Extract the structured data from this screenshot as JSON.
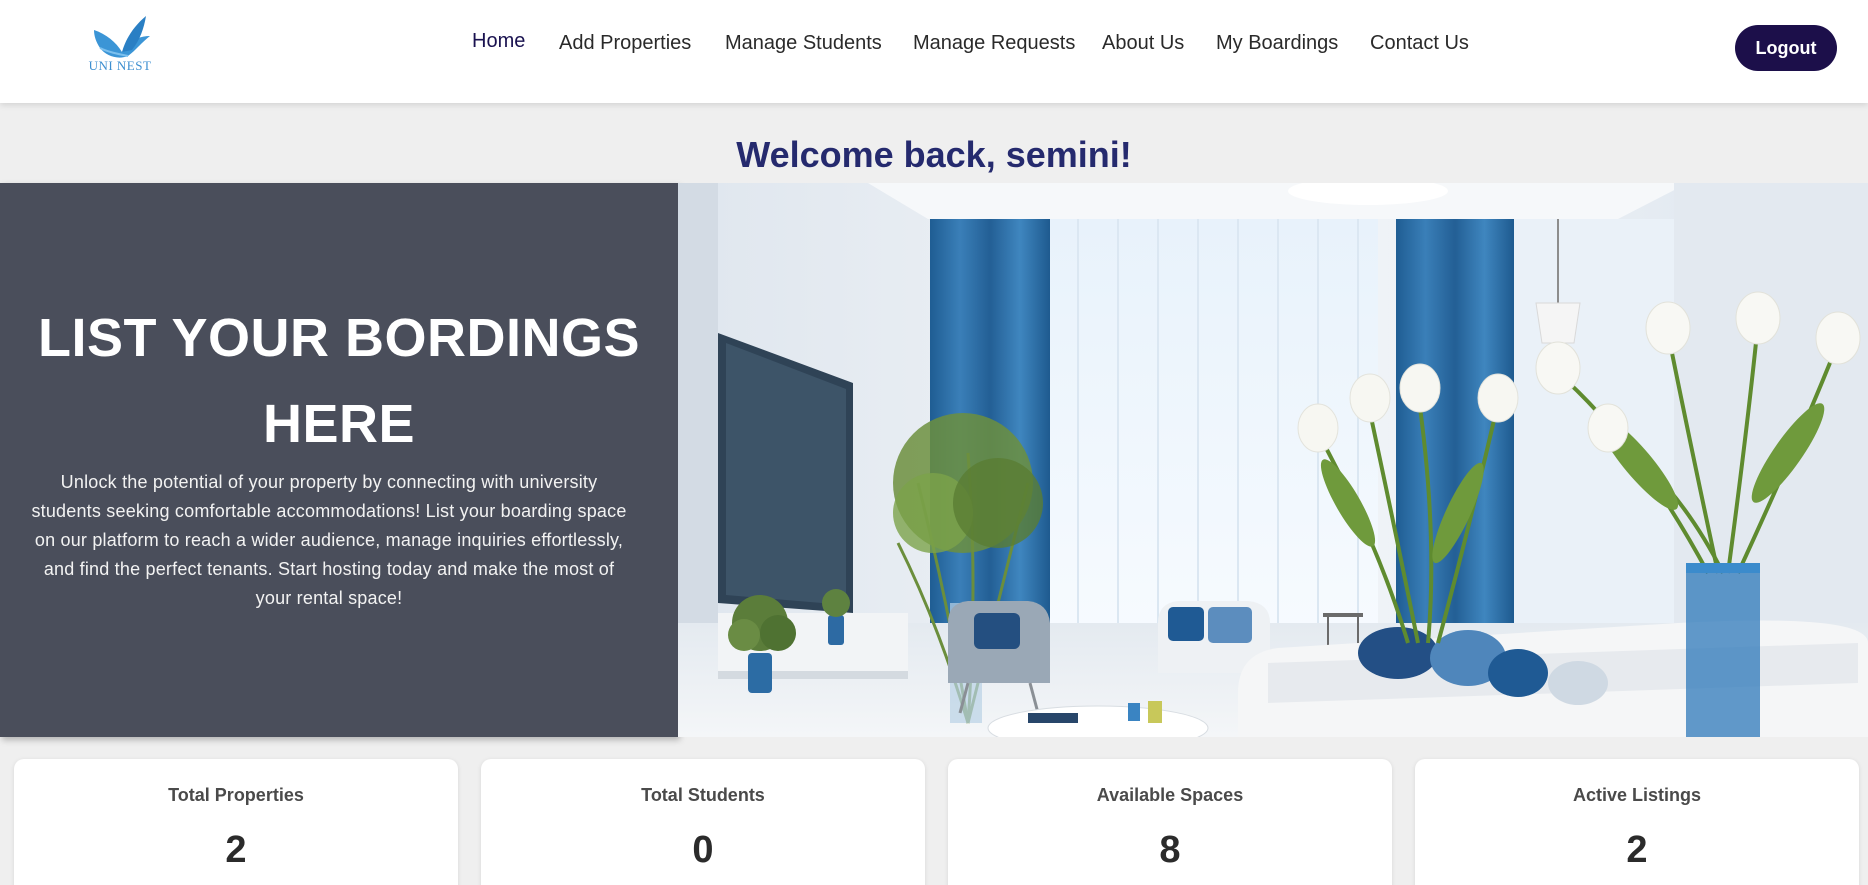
{
  "brand": {
    "logo_text": "UNI NEST",
    "accent": "#3d8fd0"
  },
  "nav": {
    "items": [
      {
        "label": "Home",
        "active": true
      },
      {
        "label": "Add Properties"
      },
      {
        "label": "Manage Students"
      },
      {
        "label": "Manage Requests"
      },
      {
        "label": "About Us"
      },
      {
        "label": "My Boardings"
      },
      {
        "label": "Contact Us"
      }
    ],
    "logout_label": "Logout"
  },
  "welcome": {
    "text": "Welcome back, semini!"
  },
  "hero": {
    "title_line1": "LIST YOUR BORDINGS",
    "title_line2": "HERE",
    "description": "Unlock the potential of your property by connecting with university students seeking comfortable accommodations! List your boarding space on our platform to reach a wider audience, manage inquiries effortlessly, and find the perfect tenants. Start hosting today and make the most of your rental space!"
  },
  "stats": [
    {
      "label": "Total Properties",
      "value": "2"
    },
    {
      "label": "Total Students",
      "value": "0"
    },
    {
      "label": "Available Spaces",
      "value": "8"
    },
    {
      "label": "Active Listings",
      "value": "2"
    }
  ],
  "colors": {
    "primary_dark": "#1c0f4a",
    "welcome_text": "#252a6e",
    "hero_panel": "#4a4e5b",
    "page_bg": "#efefef"
  }
}
